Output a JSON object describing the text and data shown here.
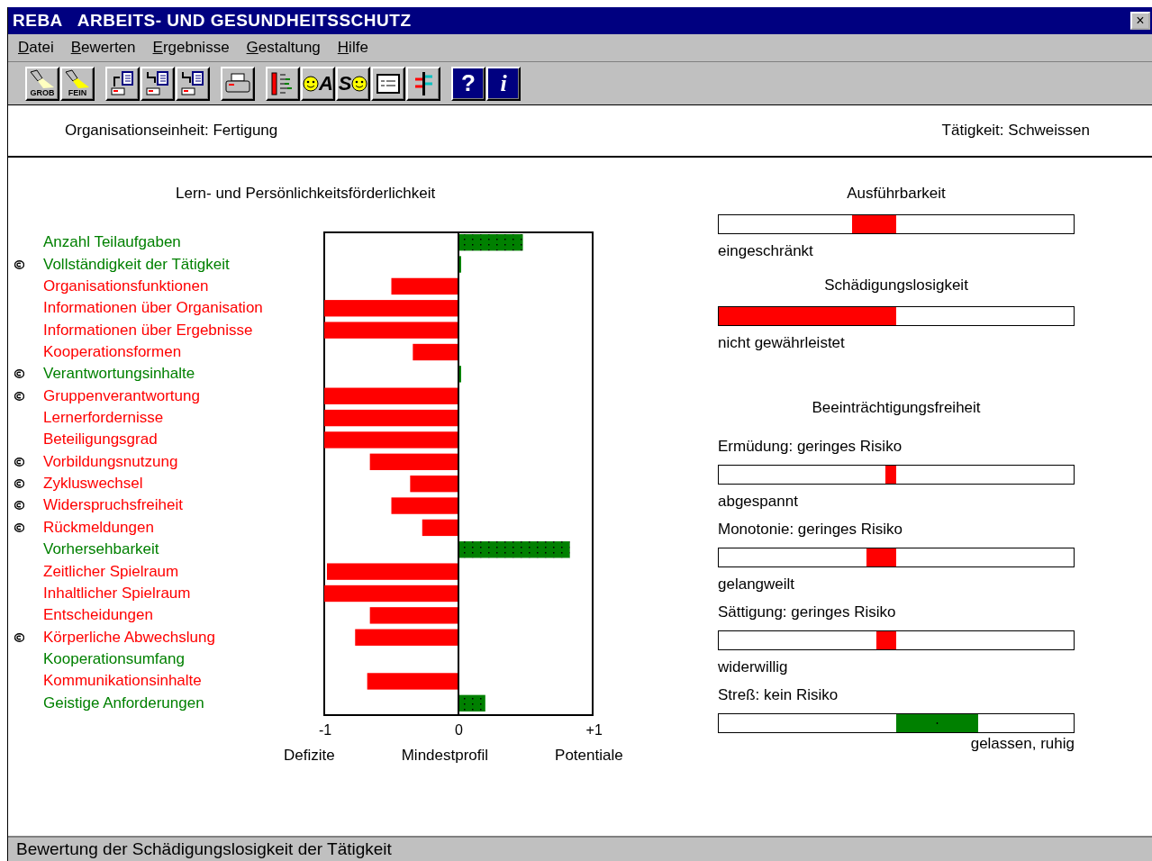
{
  "window": {
    "title": "REBA   ARBEITS- UND GESUNDHEITSSCHUTZ",
    "close": "×"
  },
  "menu": [
    "Datei",
    "Bewerten",
    "Ergebnisse",
    "Gestaltung",
    "Hilfe"
  ],
  "toolbar": [
    [
      {
        "kind": "torch",
        "text": "GROB"
      },
      {
        "kind": "torch",
        "text": "FEIN"
      }
    ],
    [
      {
        "kind": "doc-in"
      },
      {
        "kind": "doc-out"
      },
      {
        "kind": "doc-list"
      }
    ],
    [
      {
        "kind": "print"
      }
    ],
    [
      {
        "kind": "bars"
      },
      {
        "kind": "smiley-left",
        "text": "A"
      },
      {
        "kind": "smiley-right",
        "text": "S"
      },
      {
        "kind": "form"
      },
      {
        "kind": "barpair"
      }
    ],
    [
      {
        "kind": "help",
        "text": "?"
      },
      {
        "kind": "info",
        "text": "i"
      }
    ]
  ],
  "header": {
    "unit": "Organisationseinheit: Fertigung",
    "activity": "Tätigkeit: Schweissen"
  },
  "profile": {
    "title": "Lern- und Persönlichkeitsförderlichkeit",
    "rows": [
      {
        "color": "#008000",
        "marked": false
      },
      {
        "color": "#008000",
        "marked": true
      },
      {
        "color": "#ff0000",
        "marked": false
      },
      {
        "color": "#ff0000",
        "marked": false
      },
      {
        "color": "#ff0000",
        "marked": false
      },
      {
        "color": "#ff0000",
        "marked": false
      },
      {
        "color": "#008000",
        "marked": true
      },
      {
        "color": "#ff0000",
        "marked": true
      },
      {
        "color": "#ff0000",
        "marked": false
      },
      {
        "color": "#ff0000",
        "marked": false
      },
      {
        "color": "#ff0000",
        "marked": true
      },
      {
        "color": "#ff0000",
        "marked": true
      },
      {
        "color": "#ff0000",
        "marked": true
      },
      {
        "color": "#ff0000",
        "marked": true
      },
      {
        "color": "#008000",
        "marked": false
      },
      {
        "color": "#ff0000",
        "marked": false
      },
      {
        "color": "#ff0000",
        "marked": false
      },
      {
        "color": "#ff0000",
        "marked": false
      },
      {
        "color": "#ff0000",
        "marked": true
      },
      {
        "color": "#008000",
        "marked": false
      },
      {
        "color": "#ff0000",
        "marked": false
      },
      {
        "color": "#008000",
        "marked": false
      }
    ],
    "chart_data": {
      "type": "bar",
      "orientation": "horizontal",
      "categories": [
        "Anzahl Teilaufgaben",
        "Vollständigkeit der Tätigkeit",
        "Organisationsfunktionen",
        "Informationen über Organisation",
        "Informationen über Ergebnisse",
        "Kooperationsformen",
        "Verantwortungsinhalte",
        "Gruppenverantwortung",
        "Lernerfordernisse",
        "Beteiligungsgrad",
        "Vorbildungsnutzung",
        "Zykluswechsel",
        "Widerspruchsfreiheit",
        "Rückmeldungen",
        "Vorhersehbarkeit",
        "Zeitlicher Spielraum",
        "Inhaltlicher Spielraum",
        "Entscheidungen",
        "Körperliche Abwechslung",
        "Kooperationsumfang",
        "Kommunikationsinhalte",
        "Geistige Anforderungen"
      ],
      "values": [
        0.48,
        0.02,
        -0.5,
        -1,
        -1,
        -0.34,
        0.02,
        -1,
        -1,
        -1,
        -0.66,
        -0.36,
        -0.5,
        -0.27,
        0.83,
        -0.98,
        -1,
        -0.66,
        -0.77,
        0,
        -0.68,
        0.2
      ],
      "xlim": [
        -1,
        1
      ],
      "xticks": [
        {
          "value": -1,
          "label": "-1"
        },
        {
          "value": 0,
          "label": "0"
        },
        {
          "value": 1,
          "label": "+1"
        }
      ]
    },
    "axis_captions": [
      "Defizite",
      "Mindestprofil",
      "Potentiale"
    ]
  },
  "sections": [
    {
      "title": "Ausführbarkeit",
      "scales": [
        {
          "kind": "deficit",
          "color": "#ff0000",
          "caption": "eingeschränkt"
        }
      ]
    },
    {
      "title": "Schädigungslosigkeit",
      "scales": [
        {
          "kind": "deficit",
          "color": "#ff0000",
          "caption": "nicht gewährleistet"
        }
      ]
    },
    {
      "title": "Beeinträchtigungsfreiheit",
      "scales": [
        {
          "label": "Ermüdung: geringes Risiko",
          "kind": "deficit",
          "color": "#ff0000",
          "caption": "abgespannt"
        },
        {
          "label": "Monotonie: geringes Risiko",
          "kind": "deficit",
          "color": "#ff0000",
          "caption": "gelangweilt"
        },
        {
          "label": "Sättigung: geringes Risiko",
          "kind": "deficit",
          "color": "#ff0000",
          "caption": "widerwillig"
        },
        {
          "label": "Streß: kein Risiko",
          "kind": "potential",
          "color": "#008000",
          "caption": "gelassen, ruhig"
        }
      ]
    }
  ],
  "status_bar": "Bewertung der Schädigungslosigkeit der Tätigkeit"
}
